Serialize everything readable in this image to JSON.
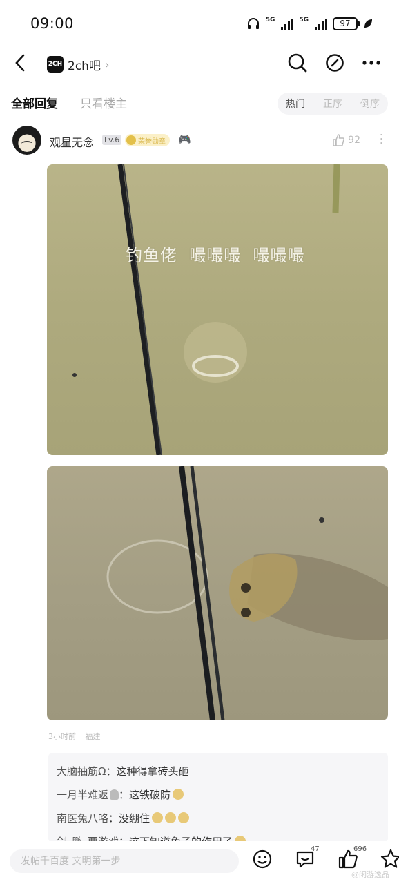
{
  "status": {
    "time": "09:00",
    "net1": "5G",
    "net2": "5G",
    "battery": "97"
  },
  "nav": {
    "back_icon": "chevron-left-icon",
    "forum_logo": "2CH",
    "forum_name": "2ch吧",
    "chevron": "›"
  },
  "tabs": {
    "all": "全部回复",
    "host_only": "只看楼主",
    "sort": [
      "热门",
      "正序",
      "倒序"
    ]
  },
  "post": {
    "username": "观星无念",
    "level": "Lv.6",
    "badge": "荣誉勋章",
    "likes": "92",
    "caption": "钓鱼佬  嘬嘬嘬  嘬嘬嘬",
    "meta": [
      "3小时前",
      "福建"
    ]
  },
  "replies": [
    {
      "user": "大脑抽筋Ω",
      "text": "：这种得拿砖头砸"
    },
    {
      "user": "一月半难返",
      "text": "：这铁破防"
    },
    {
      "user": "南医兔八咯",
      "text": "：没绷住"
    },
    {
      "user": "剑_鹏_要游戏",
      "text": "：这下知道兔子的作用了"
    }
  ],
  "bottom": {
    "placeholder": "发帖千百度 文明第一步",
    "comments": "47",
    "likes": "696",
    "watermark": "@闲游逸品"
  }
}
